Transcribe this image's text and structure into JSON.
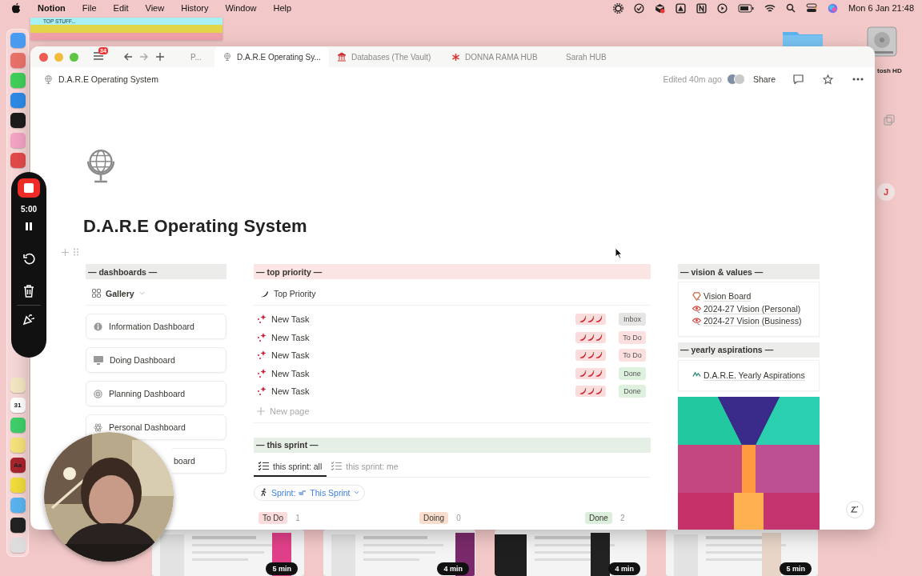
{
  "menubar": {
    "app": "Notion",
    "menus": [
      "File",
      "Edit",
      "View",
      "History",
      "Window",
      "Help"
    ],
    "clock": "Mon 6 Jan  21:48"
  },
  "sticky_note": {
    "title": "TOP STUFF..."
  },
  "dock": {
    "upper": [
      {
        "color": "#4a9cf0"
      },
      {
        "color": "#e9726a"
      },
      {
        "color": "#3fcf5a"
      },
      {
        "color": "#2d8ae6"
      },
      {
        "color": "#1c1c1c"
      },
      {
        "color": "#f3a3c4"
      },
      {
        "color": "#e24a4a"
      }
    ],
    "lower": [
      {
        "color": "#f3e6c2"
      },
      {
        "color": "#ffffff",
        "label": "31"
      },
      {
        "color": "#3fcf6a"
      },
      {
        "color": "#f5e27a"
      },
      {
        "color": "#a8252e",
        "label": "Aa"
      },
      {
        "color": "#f0dc3a"
      },
      {
        "color": "#5ab4f0"
      },
      {
        "color": "#222222"
      },
      {
        "color": "#dddddd"
      }
    ]
  },
  "recorder": {
    "time": "5:00"
  },
  "browser": {
    "badge": "34",
    "tabs": [
      {
        "label": "P...",
        "selected": false
      },
      {
        "label": "D.A.R.E Operating Sy...",
        "selected": true
      },
      {
        "label": "Databases (The Vault)",
        "selected": false
      },
      {
        "label": "DONNA RAMA HUB",
        "selected": false
      },
      {
        "label": "Sarah HUB",
        "selected": false
      }
    ]
  },
  "header": {
    "breadcrumb": "D.A.R.E Operating System",
    "edited": "Edited 40m ago",
    "share": "Share"
  },
  "page": {
    "title": "D.A.R.E Operating System"
  },
  "dashboards": {
    "heading": "— dashboards —",
    "view": "Gallery",
    "cards": [
      {
        "title": "Information Dashboard",
        "kind": "full"
      },
      {
        "title": "Doing Dashboard",
        "kind": "full"
      },
      {
        "title": "Planning Dashboard",
        "kind": "full"
      },
      {
        "title": "Personal Dashboard",
        "kind": "full"
      },
      {
        "title": "board",
        "kind": "covered"
      }
    ]
  },
  "top_priority": {
    "heading": "— top priority —",
    "view": "Top Priority",
    "rows": [
      {
        "title": "New Task",
        "status": "Inbox",
        "color": "#e6e5e3"
      },
      {
        "title": "New Task",
        "status": "To Do",
        "color": "#fbe0df"
      },
      {
        "title": "New Task",
        "status": "To Do",
        "color": "#fbe0df"
      },
      {
        "title": "New Task",
        "status": "Done",
        "color": "#def0de"
      },
      {
        "title": "New Task",
        "status": "Done",
        "color": "#def0de"
      }
    ],
    "new_page": "New page"
  },
  "sprint": {
    "heading": "— this sprint —",
    "tabs": [
      {
        "label": "this sprint: all",
        "selected": true
      },
      {
        "label": "this sprint: me",
        "selected": false
      }
    ],
    "filter": {
      "prefix": "Sprint:",
      "value": "This Sprint"
    },
    "columns": [
      {
        "name": "To Do",
        "count": "1",
        "color": "#fbdcdc"
      },
      {
        "name": "Doing",
        "count": "0",
        "color": "#f9decd"
      },
      {
        "name": "Done",
        "count": "2",
        "color": "#dcefdc"
      }
    ]
  },
  "vision": {
    "heading": "— vision & values —",
    "links": [
      "Vision Board",
      "2024-27 Vision (Personal)",
      "2024-27 Vision (Business)"
    ]
  },
  "yearly": {
    "heading": "— yearly aspirations —",
    "links": [
      "D.A.R.E. Yearly Aspirations"
    ]
  },
  "desktop": {
    "drive": "tosh HD",
    "avatar": "J"
  },
  "thumbnails": [
    {
      "badge": "5 min"
    },
    {
      "badge": "4 min"
    },
    {
      "badge": "4 min"
    },
    {
      "badge": "5 min"
    }
  ]
}
